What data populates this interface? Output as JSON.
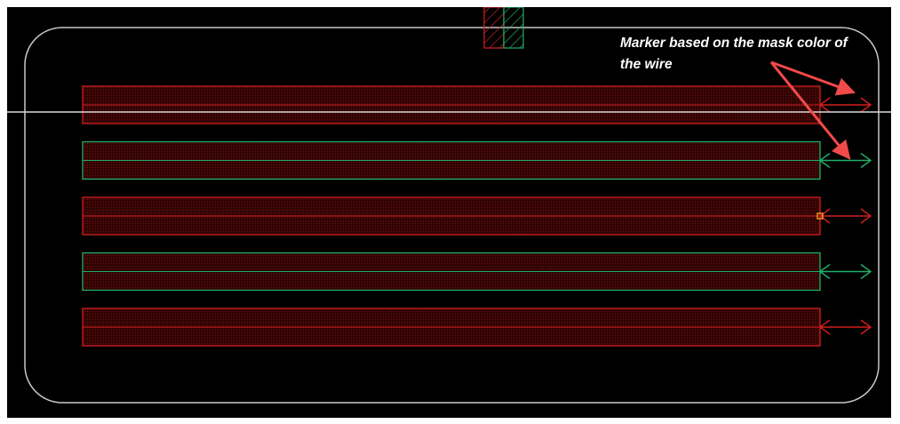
{
  "annotation": {
    "text": "Marker based on the mask color of the wire"
  },
  "colors": {
    "background": "#000000",
    "frame": "#ffffff",
    "boundary": "#c8c8c8",
    "crosshair": "#d8d8d8",
    "mask_red": "#d41e1e",
    "mask_red_fill": "#5a0606",
    "mask_green": "#1fae6a",
    "mask_green_fill": "#5a0606",
    "annotation_arrow": "#f04a4a",
    "selection_marker": "#f0a020"
  },
  "wires": [
    {
      "mask": "red",
      "marker": "arrow-double-right"
    },
    {
      "mask": "green",
      "marker": "arrow-double-right"
    },
    {
      "mask": "red",
      "marker": "arrow-double-right",
      "selected_pin": true
    },
    {
      "mask": "green",
      "marker": "arrow-double-right"
    },
    {
      "mask": "red",
      "marker": "arrow-double-right"
    }
  ],
  "via": {
    "masks": [
      "red",
      "green"
    ],
    "pattern": "hatched"
  }
}
